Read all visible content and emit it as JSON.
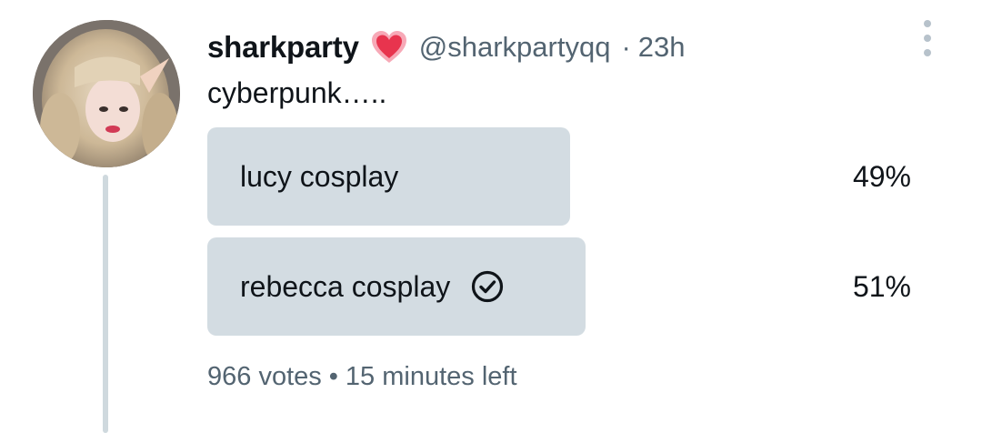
{
  "tweet": {
    "display_name": "sharkparty",
    "handle": "@sharkpartyqq",
    "separator": "·",
    "time": "23h",
    "text": "cyberpunk…..",
    "icons": {
      "name_badge": "heart-icon",
      "more": "more-vertical-icon",
      "selected": "check-circle-icon"
    },
    "colors": {
      "heart": "#e8344e",
      "bar": "#d3dce2",
      "muted_text": "#536471",
      "thread_line": "#cfd9de"
    }
  },
  "poll": {
    "options": [
      {
        "label": "lucy cosplay",
        "percent_text": "49%",
        "percent": 49,
        "selected": false
      },
      {
        "label": "rebecca cosplay",
        "percent_text": "51%",
        "percent": 51,
        "selected": true
      }
    ],
    "votes": "966 votes",
    "dot": "•",
    "time_left": "15 minutes left"
  }
}
